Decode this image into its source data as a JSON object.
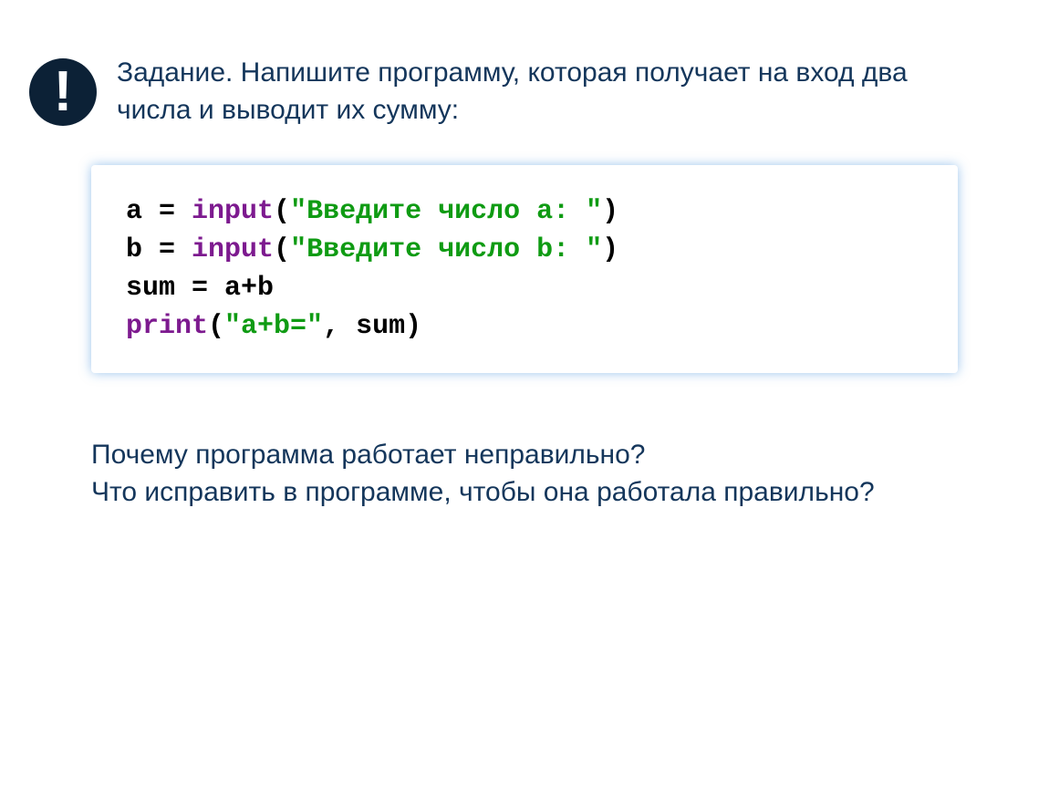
{
  "header": {
    "badge_symbol": "!",
    "task_text": "Задание. Напишите программу, которая получает на вход два числа и выводит их сумму:"
  },
  "code": {
    "line1": {
      "a": "a ",
      "eq": "= ",
      "fn": "input",
      "open": "(",
      "str": "\"Введите число a: \"",
      "close": ")"
    },
    "line2": {
      "b": "b ",
      "eq": "= ",
      "fn": "input",
      "open": "(",
      "str": "\"Введите число b: \"",
      "close": ")"
    },
    "line3": {
      "text": "sum = a+b"
    },
    "line4": {
      "fn": "print",
      "open": "(",
      "str": "\"a+b=\"",
      "comma": ", sum",
      "close": ")"
    }
  },
  "questions": {
    "q1": "Почему программа работает неправильно?",
    "q2": "Что исправить в программе, чтобы она работала правильно?"
  }
}
